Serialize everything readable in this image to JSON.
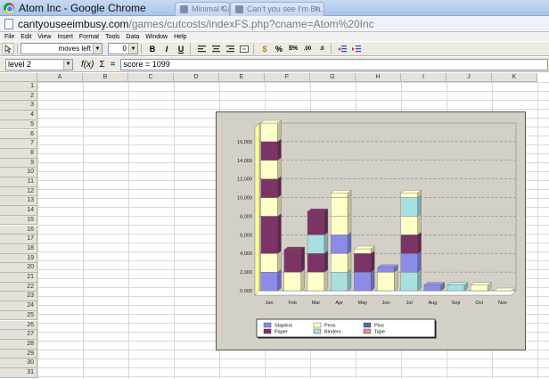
{
  "window": {
    "title": "Atom Inc - Google Chrome",
    "tabs": [
      {
        "label": "Minimal Ganing ...",
        "x": 196,
        "w": 62
      },
      {
        "label": "Can't you see I'm Bu...",
        "x": 258,
        "w": 106
      }
    ]
  },
  "address": {
    "host": "cantyouseeimbusy.com",
    "path": "/games/cutcosts/indexFS.php?cname=Atom%20Inc"
  },
  "menu": [
    "File",
    "Edit",
    "View",
    "Insert",
    "Format",
    "Tools",
    "Data",
    "Window",
    "Help"
  ],
  "toolbar": {
    "font_box": "moves left",
    "size_box": "0",
    "bold": "B",
    "italic": "I",
    "underline": "U"
  },
  "formula": {
    "name_box": "level 2",
    "fx": "f(x)",
    "sigma": "Σ",
    "equals": "=",
    "content": "score =  1099"
  },
  "sheet": {
    "columns": [
      "A",
      "B",
      "C",
      "D",
      "E",
      "F",
      "G",
      "H",
      "I",
      "J",
      "K"
    ],
    "rows": [
      "1",
      "2",
      "3",
      "4",
      "5",
      "6",
      "7",
      "8",
      "9",
      "10",
      "11",
      "12",
      "13",
      "14",
      "15",
      "16",
      "17",
      "18",
      "19",
      "20",
      "21",
      "22",
      "23",
      "24",
      "25",
      "26",
      "27",
      "28",
      "29",
      "30",
      "31"
    ]
  },
  "chart_data": {
    "type": "bar",
    "stacked": true,
    "categories": [
      "Jan",
      "Feb",
      "Mar",
      "Apr",
      "May",
      "Jun",
      "Jul",
      "Aug",
      "Sep",
      "Oct",
      "Nov"
    ],
    "ytick_labels": [
      "0.000",
      "2,000",
      "4,000",
      "6,000",
      "8,000",
      "10,000",
      "12,000",
      "14,000",
      "16,000"
    ],
    "ylim": [
      0,
      18000
    ],
    "grid": true,
    "legend_placement": "bottom",
    "series": [
      {
        "name": "Staplers",
        "color": "#8c8ce8",
        "values": [
          2000,
          0,
          0,
          0,
          2000,
          0,
          0,
          600,
          0,
          0,
          0
        ]
      },
      {
        "name": "Pens",
        "color": "#ffffc8",
        "values": [
          2000,
          2000,
          2000,
          4000,
          0,
          2000,
          2000,
          0,
          0,
          600,
          0
        ]
      },
      {
        "name": "Pins",
        "color": "#4a6fa8",
        "values": [
          0,
          0,
          0,
          0,
          0,
          600,
          0,
          0,
          0,
          0,
          0
        ]
      },
      {
        "name": "Paper",
        "color": "#7c3466",
        "values": [
          6000,
          2000,
          2000,
          0,
          2000,
          0,
          2000,
          0,
          0,
          0,
          0
        ]
      },
      {
        "name": "Binders",
        "color": "#a8e0e0",
        "values": [
          0,
          0,
          2000,
          2000,
          0,
          0,
          2000,
          0,
          600,
          0,
          0
        ]
      },
      {
        "name": "Tape",
        "color": "#e88c8c",
        "values": [
          0,
          0,
          0,
          0,
          0,
          0,
          0,
          0,
          0,
          0,
          0
        ]
      }
    ],
    "segment_order": [
      [
        [
          "Staplers",
          2000
        ],
        [
          "Pens",
          2000
        ],
        [
          "Paper",
          4000
        ],
        [
          "Pens",
          2000
        ],
        [
          "Paper",
          2000
        ],
        [
          "Pens",
          2000
        ],
        [
          "Paper",
          2000
        ],
        [
          "Pens",
          2000
        ]
      ],
      [
        [
          "Pens",
          2000
        ],
        [
          "Paper",
          2000
        ],
        [
          "Paper",
          400
        ]
      ],
      [
        [
          "Pens",
          2000
        ],
        [
          "Paper",
          2000
        ],
        [
          "Binders",
          2000
        ],
        [
          "Paper",
          2000
        ],
        [
          "Paper",
          500
        ]
      ],
      [
        [
          "Binders",
          2000
        ],
        [
          "Pens",
          2000
        ],
        [
          "Staplers",
          2000
        ],
        [
          "Pens",
          2000
        ],
        [
          "Pens",
          2000
        ],
        [
          "Pens",
          500
        ]
      ],
      [
        [
          "Staplers",
          2000
        ],
        [
          "Paper",
          2000
        ],
        [
          "Pens",
          500
        ]
      ],
      [
        [
          "Pens",
          2000
        ],
        [
          "Staplers",
          500
        ]
      ],
      [
        [
          "Binders",
          2000
        ],
        [
          "Staplers",
          2000
        ],
        [
          "Paper",
          2000
        ],
        [
          "Pens",
          2000
        ],
        [
          "Binders",
          2000
        ],
        [
          "Pens",
          500
        ]
      ],
      [
        [
          "Staplers",
          600
        ]
      ],
      [
        [
          "Binders",
          600
        ]
      ],
      [
        [
          "Pens",
          600
        ]
      ],
      [
        [
          "Pens",
          0
        ]
      ]
    ]
  }
}
